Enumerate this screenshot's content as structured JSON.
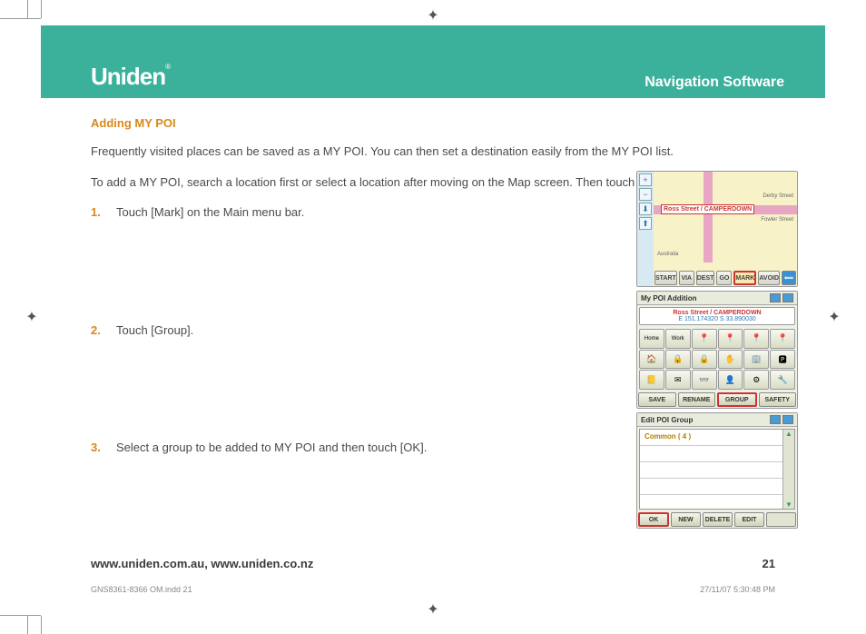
{
  "header": {
    "logo": "Uniden",
    "section": "Navigation Software"
  },
  "title": "Adding MY POI",
  "paragraphs": [
    "Frequently visited places can be saved as a MY POI. You can then set a destination easily from the MY POI list.",
    "To add a MY POI, search a location first or select a location after moving on the Map screen. Then touch [Main]."
  ],
  "steps": [
    {
      "n": "1.",
      "text": "Touch [Mark] on the Main menu bar."
    },
    {
      "n": "2.",
      "text": "Touch [Group]."
    },
    {
      "n": "3.",
      "text": "Select a group to be added to MY POI and then touch [OK]."
    }
  ],
  "screen1": {
    "label": "Ross Street / CAMPERDOWN",
    "streets": {
      "a": "Derby Street",
      "b": "Fowler Street",
      "c": "Australia"
    },
    "buttons": [
      "START",
      "VIA",
      "DEST",
      "GO",
      "MARK",
      "AVOID"
    ]
  },
  "screen2": {
    "title": "My POI Addition",
    "info1": "Ross Street / CAMPERDOWN",
    "info2": "E 151.174320   S 33.890030",
    "icons_row1": [
      "Home",
      "Work",
      "📍",
      "📍",
      "📍",
      "📍"
    ],
    "buttons": [
      "SAVE",
      "RENAME",
      "GROUP",
      "SAFETY"
    ]
  },
  "screen3": {
    "title": "Edit POI Group",
    "row": "Common ( 4 )",
    "buttons": [
      "OK",
      "NEW",
      "DELETE",
      "EDIT",
      ""
    ]
  },
  "footer": {
    "urls": "www.uniden.com.au, www.uniden.co.nz",
    "page": "21"
  },
  "print": {
    "file": "GNS8361-8366 OM.indd   21",
    "stamp": "27/11/07   5:30:48 PM"
  }
}
